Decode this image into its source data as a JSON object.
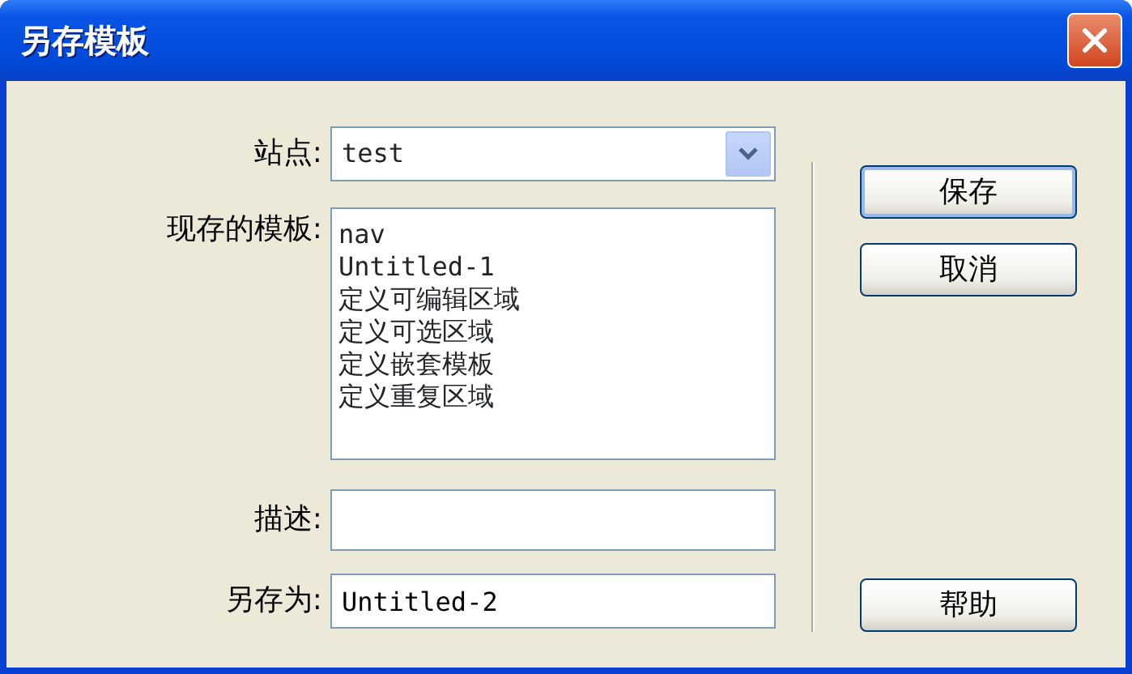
{
  "window": {
    "title": "另存模板"
  },
  "site": {
    "label": "站点:",
    "value": "test"
  },
  "templates": {
    "label": "现存的模板:",
    "items": [
      {
        "text": "nav",
        "selected": false
      },
      {
        "text": "Untitled-1",
        "selected": false
      },
      {
        "text": "定义可编辑区域",
        "selected": false
      },
      {
        "text": "定义可选区域",
        "selected": false
      },
      {
        "text": "定义嵌套模板",
        "selected": false
      },
      {
        "text": "定义重复区域",
        "selected": false
      }
    ]
  },
  "description": {
    "label": "描述:"
  },
  "save_as": {
    "label": "另存为:",
    "value": "Untitled-2"
  },
  "buttons": [
    {
      "label": "保存",
      "kind": "default"
    },
    {
      "label": "取消",
      "kind": "normal"
    },
    {
      "label": "帮助",
      "kind": "normal"
    }
  ]
}
